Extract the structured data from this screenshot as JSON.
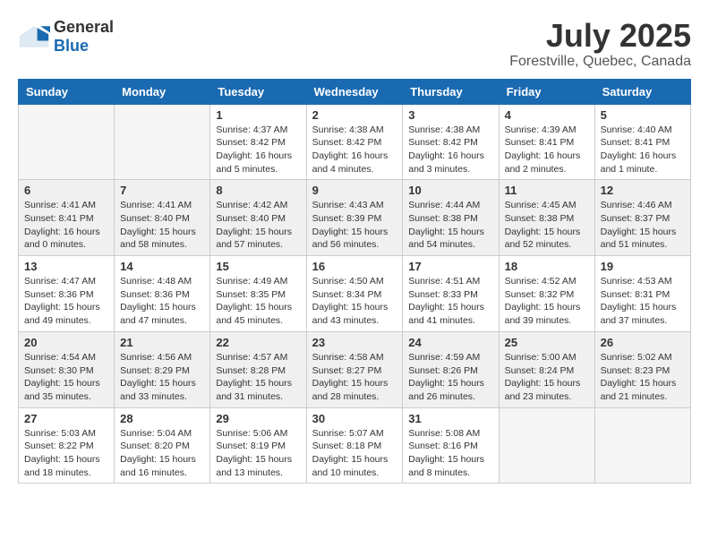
{
  "header": {
    "logo_general": "General",
    "logo_blue": "Blue",
    "month": "July 2025",
    "location": "Forestville, Quebec, Canada"
  },
  "weekdays": [
    "Sunday",
    "Monday",
    "Tuesday",
    "Wednesday",
    "Thursday",
    "Friday",
    "Saturday"
  ],
  "weeks": [
    [
      {
        "day": "",
        "info": ""
      },
      {
        "day": "",
        "info": ""
      },
      {
        "day": "1",
        "info": "Sunrise: 4:37 AM\nSunset: 8:42 PM\nDaylight: 16 hours\nand 5 minutes."
      },
      {
        "day": "2",
        "info": "Sunrise: 4:38 AM\nSunset: 8:42 PM\nDaylight: 16 hours\nand 4 minutes."
      },
      {
        "day": "3",
        "info": "Sunrise: 4:38 AM\nSunset: 8:42 PM\nDaylight: 16 hours\nand 3 minutes."
      },
      {
        "day": "4",
        "info": "Sunrise: 4:39 AM\nSunset: 8:41 PM\nDaylight: 16 hours\nand 2 minutes."
      },
      {
        "day": "5",
        "info": "Sunrise: 4:40 AM\nSunset: 8:41 PM\nDaylight: 16 hours\nand 1 minute."
      }
    ],
    [
      {
        "day": "6",
        "info": "Sunrise: 4:41 AM\nSunset: 8:41 PM\nDaylight: 16 hours\nand 0 minutes."
      },
      {
        "day": "7",
        "info": "Sunrise: 4:41 AM\nSunset: 8:40 PM\nDaylight: 15 hours\nand 58 minutes."
      },
      {
        "day": "8",
        "info": "Sunrise: 4:42 AM\nSunset: 8:40 PM\nDaylight: 15 hours\nand 57 minutes."
      },
      {
        "day": "9",
        "info": "Sunrise: 4:43 AM\nSunset: 8:39 PM\nDaylight: 15 hours\nand 56 minutes."
      },
      {
        "day": "10",
        "info": "Sunrise: 4:44 AM\nSunset: 8:38 PM\nDaylight: 15 hours\nand 54 minutes."
      },
      {
        "day": "11",
        "info": "Sunrise: 4:45 AM\nSunset: 8:38 PM\nDaylight: 15 hours\nand 52 minutes."
      },
      {
        "day": "12",
        "info": "Sunrise: 4:46 AM\nSunset: 8:37 PM\nDaylight: 15 hours\nand 51 minutes."
      }
    ],
    [
      {
        "day": "13",
        "info": "Sunrise: 4:47 AM\nSunset: 8:36 PM\nDaylight: 15 hours\nand 49 minutes."
      },
      {
        "day": "14",
        "info": "Sunrise: 4:48 AM\nSunset: 8:36 PM\nDaylight: 15 hours\nand 47 minutes."
      },
      {
        "day": "15",
        "info": "Sunrise: 4:49 AM\nSunset: 8:35 PM\nDaylight: 15 hours\nand 45 minutes."
      },
      {
        "day": "16",
        "info": "Sunrise: 4:50 AM\nSunset: 8:34 PM\nDaylight: 15 hours\nand 43 minutes."
      },
      {
        "day": "17",
        "info": "Sunrise: 4:51 AM\nSunset: 8:33 PM\nDaylight: 15 hours\nand 41 minutes."
      },
      {
        "day": "18",
        "info": "Sunrise: 4:52 AM\nSunset: 8:32 PM\nDaylight: 15 hours\nand 39 minutes."
      },
      {
        "day": "19",
        "info": "Sunrise: 4:53 AM\nSunset: 8:31 PM\nDaylight: 15 hours\nand 37 minutes."
      }
    ],
    [
      {
        "day": "20",
        "info": "Sunrise: 4:54 AM\nSunset: 8:30 PM\nDaylight: 15 hours\nand 35 minutes."
      },
      {
        "day": "21",
        "info": "Sunrise: 4:56 AM\nSunset: 8:29 PM\nDaylight: 15 hours\nand 33 minutes."
      },
      {
        "day": "22",
        "info": "Sunrise: 4:57 AM\nSunset: 8:28 PM\nDaylight: 15 hours\nand 31 minutes."
      },
      {
        "day": "23",
        "info": "Sunrise: 4:58 AM\nSunset: 8:27 PM\nDaylight: 15 hours\nand 28 minutes."
      },
      {
        "day": "24",
        "info": "Sunrise: 4:59 AM\nSunset: 8:26 PM\nDaylight: 15 hours\nand 26 minutes."
      },
      {
        "day": "25",
        "info": "Sunrise: 5:00 AM\nSunset: 8:24 PM\nDaylight: 15 hours\nand 23 minutes."
      },
      {
        "day": "26",
        "info": "Sunrise: 5:02 AM\nSunset: 8:23 PM\nDaylight: 15 hours\nand 21 minutes."
      }
    ],
    [
      {
        "day": "27",
        "info": "Sunrise: 5:03 AM\nSunset: 8:22 PM\nDaylight: 15 hours\nand 18 minutes."
      },
      {
        "day": "28",
        "info": "Sunrise: 5:04 AM\nSunset: 8:20 PM\nDaylight: 15 hours\nand 16 minutes."
      },
      {
        "day": "29",
        "info": "Sunrise: 5:06 AM\nSunset: 8:19 PM\nDaylight: 15 hours\nand 13 minutes."
      },
      {
        "day": "30",
        "info": "Sunrise: 5:07 AM\nSunset: 8:18 PM\nDaylight: 15 hours\nand 10 minutes."
      },
      {
        "day": "31",
        "info": "Sunrise: 5:08 AM\nSunset: 8:16 PM\nDaylight: 15 hours\nand 8 minutes."
      },
      {
        "day": "",
        "info": ""
      },
      {
        "day": "",
        "info": ""
      }
    ]
  ]
}
